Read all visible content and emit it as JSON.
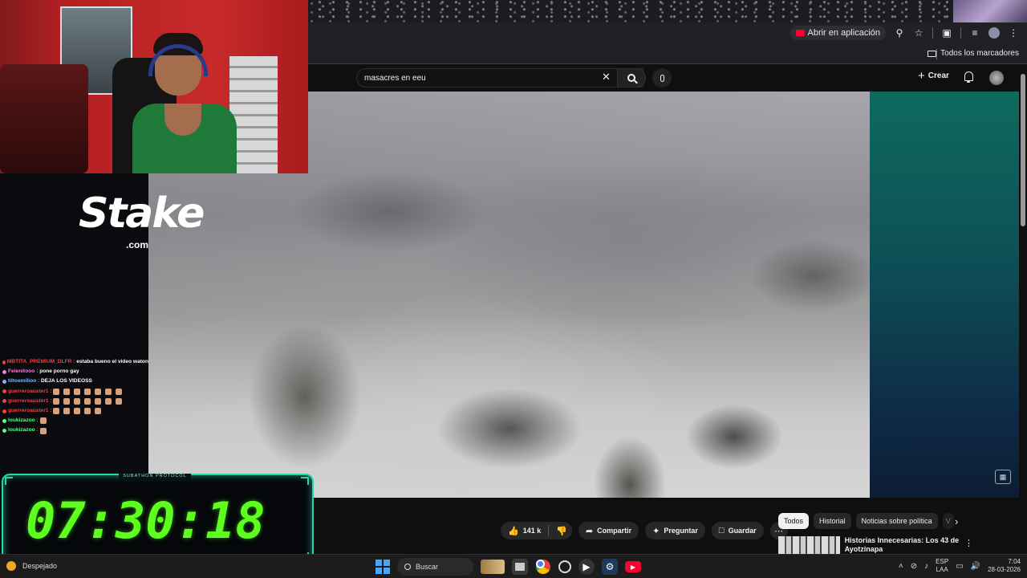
{
  "browser": {
    "open_in_app_label": "Abrir en aplicación",
    "all_bookmarks_label": "Todos los marcadores"
  },
  "youtube": {
    "search_value": "masacres en eeu",
    "create_label": "Crear",
    "actions": {
      "likes": "141 k",
      "share": "Compartir",
      "ask": "Preguntar",
      "save": "Guardar"
    },
    "chips": [
      "Todos",
      "Historial",
      "Noticias sobre política",
      "V"
    ],
    "recommendation": {
      "title": "Historias Innecesarias: Los 43 de Ayotzinapa"
    }
  },
  "stream": {
    "sponsor": "Stake",
    "sponsor_tld": ".com",
    "chat": [
      {
        "user": "MBTITA_PREMIUM_DLFR",
        "text": "estaba bueno el video waton",
        "color": "#ff3b3b"
      },
      {
        "user": "Felenitooo",
        "text": "pone porno gay",
        "color": "#ff7ad1"
      },
      {
        "user": "tiltoemilioo",
        "text": "DEJA LOS VIDEOSS",
        "color": "#7fb3ff"
      },
      {
        "user": "guerreroauster1",
        "text": "",
        "emotes": 7,
        "color": "#ff3b3b"
      },
      {
        "user": "guerreroauster1",
        "text": "",
        "emotes": 7,
        "color": "#ff3b3b"
      },
      {
        "user": "guerreroauster1",
        "text": "",
        "emotes": 5,
        "color": "#ff3b3b"
      },
      {
        "user": "loukizazoo",
        "text": "",
        "emotes": 1,
        "color": "#5dff8c"
      },
      {
        "user": "loukizazoo",
        "text": "",
        "emotes": 1,
        "color": "#5dff8c"
      }
    ],
    "timer_label": "SUBATHON PROTOCOL",
    "timer": "07:30:18"
  },
  "taskbar": {
    "weather": "Despejado",
    "search_label": "Buscar",
    "lang_top": "ESP",
    "lang_bottom": "LAA",
    "time": "7:04",
    "date": "28-03-2026"
  }
}
